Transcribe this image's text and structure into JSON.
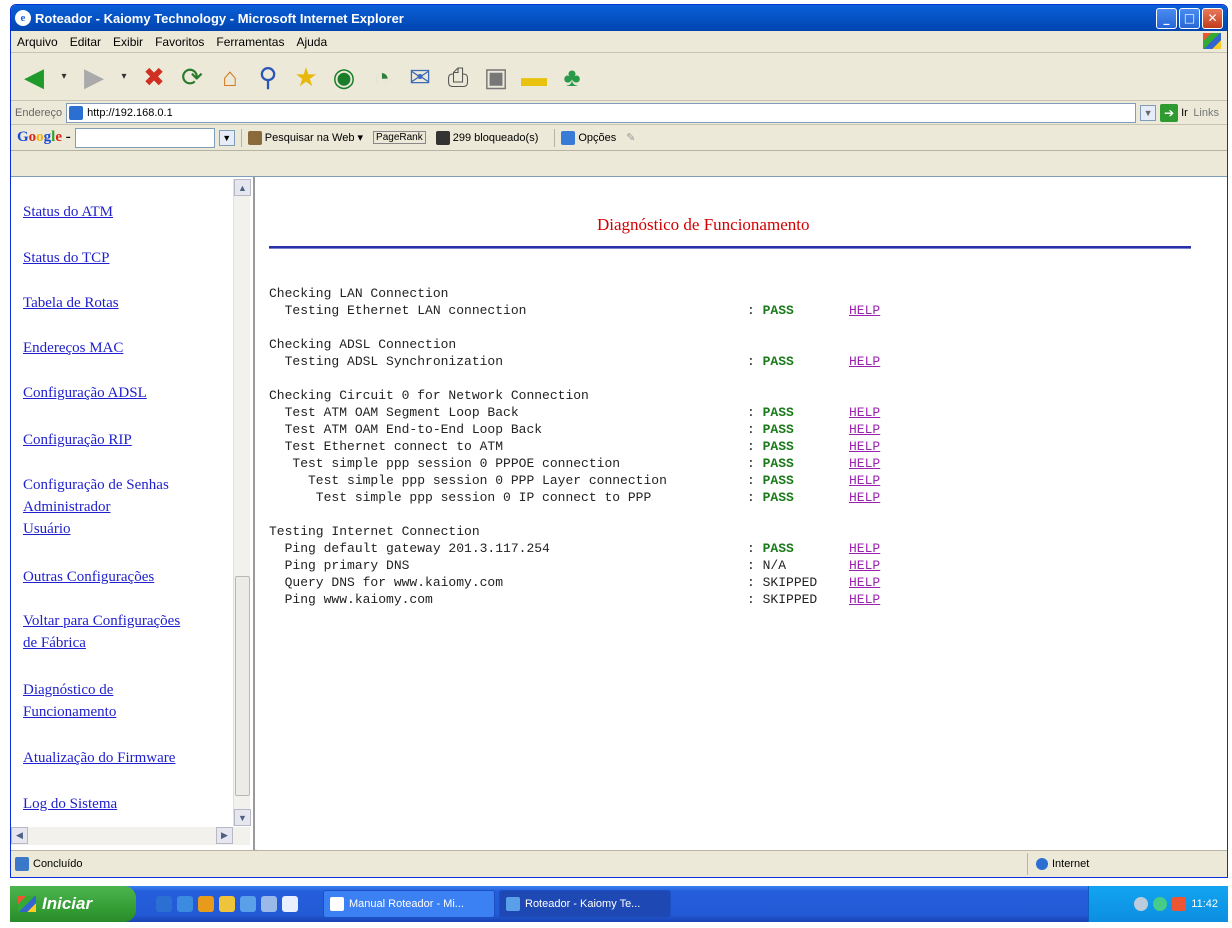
{
  "window": {
    "title": "Roteador - Kaiomy Technology - Microsoft Internet Explorer",
    "minimize": "_",
    "maximize": "□",
    "close": "✕"
  },
  "menubar": {
    "items": [
      "Arquivo",
      "Editar",
      "Exibir",
      "Favoritos",
      "Ferramentas",
      "Ajuda"
    ]
  },
  "addressbar": {
    "label": "Endereço",
    "url": "http://192.168.0.1",
    "go_label": "Ir",
    "links_label": "Links"
  },
  "googlebar": {
    "search_web": "Pesquisar na Web",
    "pagerank": "PageRank",
    "blocked": "299 bloqueado(s)",
    "options": "Opções"
  },
  "nav": {
    "items": [
      "Status do ATM",
      "Status do TCP",
      "Tabela de Rotas",
      "Endereços MAC",
      "Configuração ADSL",
      "Configuração RIP",
      "Configuração de Senhas",
      "Administrador",
      "Usuário",
      "Outras Configurações",
      "Voltar para Configurações",
      "de Fábrica",
      "Diagnóstico de",
      "Funcionamento",
      "Atualização do Firmware",
      "Log do Sistema"
    ]
  },
  "main": {
    "title": "Diagnóstico de Funcionamento",
    "sections": [
      {
        "heading": "Checking LAN Connection",
        "rows": [
          {
            "label": "  Testing Ethernet LAN connection",
            "result": "PASS",
            "help": "HELP"
          }
        ]
      },
      {
        "heading": "Checking ADSL Connection",
        "rows": [
          {
            "label": "  Testing ADSL Synchronization",
            "result": "PASS",
            "help": "HELP"
          }
        ]
      },
      {
        "heading": "Checking Circuit 0 for Network Connection",
        "rows": [
          {
            "label": "  Test ATM OAM Segment Loop Back",
            "result": "PASS",
            "help": "HELP"
          },
          {
            "label": "  Test ATM OAM End-to-End Loop Back",
            "result": "PASS",
            "help": "HELP"
          },
          {
            "label": "  Test Ethernet connect to ATM",
            "result": "PASS",
            "help": "HELP"
          },
          {
            "label": "   Test simple ppp session 0 PPPOE connection",
            "result": "PASS",
            "help": "HELP"
          },
          {
            "label": "     Test simple ppp session 0 PPP Layer connection",
            "result": "PASS",
            "help": "HELP"
          },
          {
            "label": "      Test simple ppp session 0 IP connect to PPP",
            "result": "PASS",
            "help": "HELP"
          }
        ]
      },
      {
        "heading": "Testing Internet Connection",
        "rows": [
          {
            "label": "  Ping default gateway 201.3.117.254",
            "result": "PASS",
            "help": "HELP"
          },
          {
            "label": "  Ping primary DNS",
            "result": "N/A",
            "help": "HELP"
          },
          {
            "label": "  Query DNS for www.kaiomy.com",
            "result": "SKIPPED",
            "help": "HELP"
          },
          {
            "label": "  Ping www.kaiomy.com",
            "result": "SKIPPED",
            "help": "HELP"
          }
        ]
      }
    ],
    "colon": ":"
  },
  "statusbar": {
    "status": "Concluído",
    "zone": "Internet"
  },
  "taskbar": {
    "start": "Iniciar",
    "tasks": [
      "Manual Roteador - Mi...",
      "Roteador - Kaiomy Te..."
    ],
    "clock": "11:42"
  },
  "colors": {
    "title_red": "#d40000",
    "pass_green": "#1a7a1a",
    "help_purple": "#9b22b0",
    "nav_link": "#1f1fcd",
    "rule_blue": "#2831a7"
  }
}
